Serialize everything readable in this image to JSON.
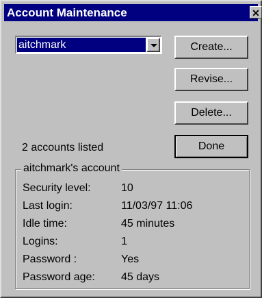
{
  "window": {
    "title": "Account Maintenance",
    "close_glyph": "✕"
  },
  "account_select": {
    "value": "aitchmark"
  },
  "buttons": {
    "create": "Create...",
    "revise": "Revise...",
    "delete": "Delete...",
    "done": "Done"
  },
  "status_text": "2 accounts listed",
  "details": {
    "legend": "aitchmark's account",
    "rows": [
      {
        "label": "Security level:",
        "value": "10"
      },
      {
        "label": "Last login:",
        "value": "11/03/97 11:06"
      },
      {
        "label": "Idle time:",
        "value": "45 minutes"
      },
      {
        "label": "Logins:",
        "value": "1"
      },
      {
        "label": "Password :",
        "value": "Yes"
      },
      {
        "label": "Password age:",
        "value": "45 days"
      }
    ]
  }
}
